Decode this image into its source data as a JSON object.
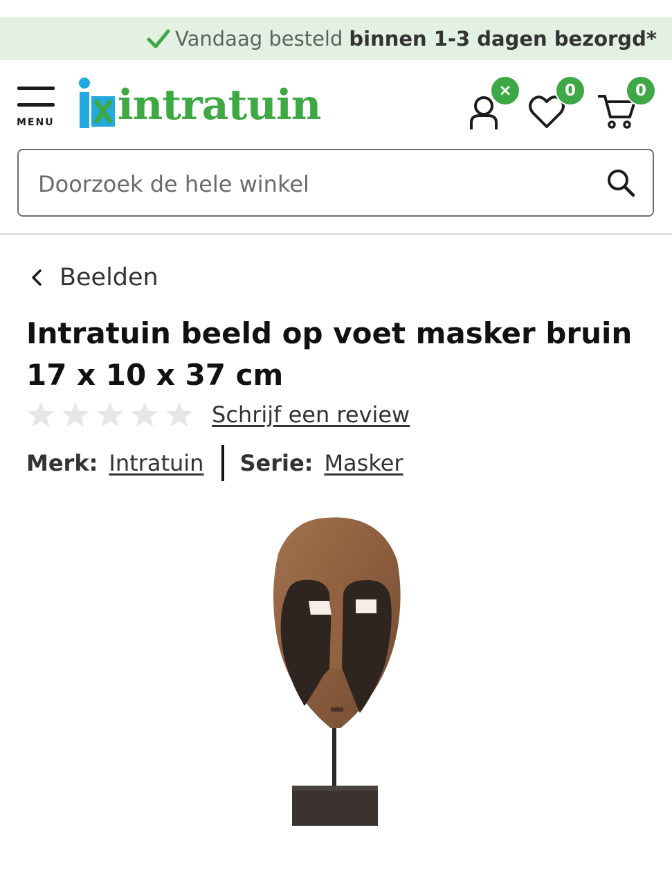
{
  "banner": {
    "light_text": "Vandaag besteld",
    "bold_text": "binnen 1-3 dagen bezorgd*",
    "icon": "check-icon",
    "accent": "#3fa846"
  },
  "header": {
    "menu_label": "MENU",
    "logo_text": "intratuin",
    "account_badge": "×",
    "wishlist_count": "0",
    "cart_count": "0"
  },
  "search": {
    "placeholder": "Doorzoek de hele winkel"
  },
  "breadcrumb": {
    "label": "Beelden"
  },
  "product": {
    "title": "Intratuin beeld op voet masker bruin 17 x 10 x 37 cm",
    "review_link": "Schrijf een review",
    "brand_label": "Merk:",
    "brand_value": "Intratuin",
    "series_label": "Serie:",
    "series_value": "Masker",
    "rating_stars": 0,
    "image_alt": "masker beeld"
  },
  "colors": {
    "brand_green": "#3ea843",
    "brand_blue": "#22a9e0",
    "banner_bg": "#e3f1e2"
  }
}
